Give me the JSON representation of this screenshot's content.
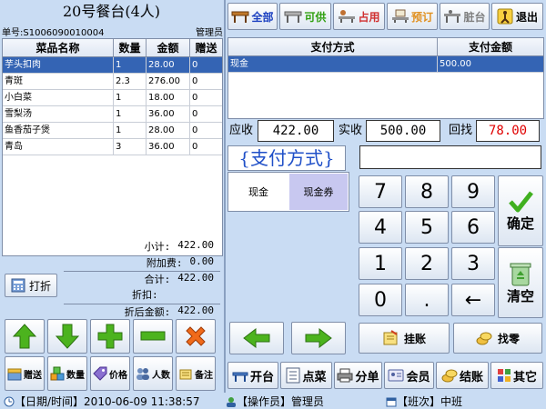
{
  "order": {
    "title": "20号餐台(4人)",
    "number": "单号:S1006090010004",
    "operator": "管理员"
  },
  "dish_table": {
    "headers": [
      "菜品名称",
      "数量",
      "金额",
      "赠送"
    ],
    "rows": [
      {
        "name": "芋头扣肉",
        "qty": "1",
        "amount": "28.00",
        "gift": "0"
      },
      {
        "name": "青斑",
        "qty": "2.3",
        "amount": "276.00",
        "gift": "0"
      },
      {
        "name": "小白菜",
        "qty": "1",
        "amount": "18.00",
        "gift": "0"
      },
      {
        "name": "雪梨汤",
        "qty": "1",
        "amount": "36.00",
        "gift": "0"
      },
      {
        "name": "鱼香茄子煲",
        "qty": "1",
        "amount": "28.00",
        "gift": "0"
      },
      {
        "name": "青岛",
        "qty": "3",
        "amount": "36.00",
        "gift": "0"
      }
    ]
  },
  "totals": {
    "subtotal_label": "小计:",
    "subtotal": "422.00",
    "surcharge_label": "附加费:",
    "surcharge": "0.00",
    "sum_label": "合计:",
    "sum": "422.00",
    "discount_label": "折扣:",
    "discount": "",
    "after_label": "折后金额:",
    "after": "422.00"
  },
  "discount_button": "打折",
  "edit_buttons": {
    "gift": "赠送",
    "qty": "数量",
    "price": "价格",
    "people": "人数",
    "note": "备注"
  },
  "filters": {
    "all": "全部",
    "available": "可供",
    "occupied": "占用",
    "reserved": "预订",
    "dirty": "脏台",
    "exit": "退出"
  },
  "pay_table": {
    "headers": [
      "支付方式",
      "支付金额"
    ],
    "rows": [
      {
        "method": "现金",
        "amount": "500.00"
      }
    ]
  },
  "amounts": {
    "due_label": "应收",
    "due": "422.00",
    "paid_label": "实收",
    "paid": "500.00",
    "change_label": "回找",
    "change": "78.00"
  },
  "payment_methods": {
    "header": "{支付方式}",
    "cash": "现金",
    "voucher": "现金券"
  },
  "keypad": {
    "k7": "7",
    "k8": "8",
    "k9": "9",
    "k4": "4",
    "k5": "5",
    "k6": "6",
    "k1": "1",
    "k2": "2",
    "k3": "3",
    "k0": "0",
    "dot": ".",
    "back": "←",
    "confirm": "确定",
    "clear": "清空"
  },
  "actions": {
    "credit": "挂账",
    "find_change": "找零"
  },
  "bottom": {
    "open": "开台",
    "order": "点菜",
    "split": "分单",
    "member": "会员",
    "checkout": "结账",
    "other": "其它"
  },
  "status": {
    "datetime_label": "【日期/时间】",
    "datetime": "2010-06-09 11:38:57",
    "operator_label": "【操作员】",
    "operator": "管理员",
    "shift_label": "【班次】",
    "shift": "中班"
  },
  "colors": {
    "background": "#c9dcf3",
    "selected_row": "#3464b4",
    "change_red": "#e00000",
    "payment_blue": "#2050c8",
    "voucher_bg": "#c8c8f0"
  }
}
